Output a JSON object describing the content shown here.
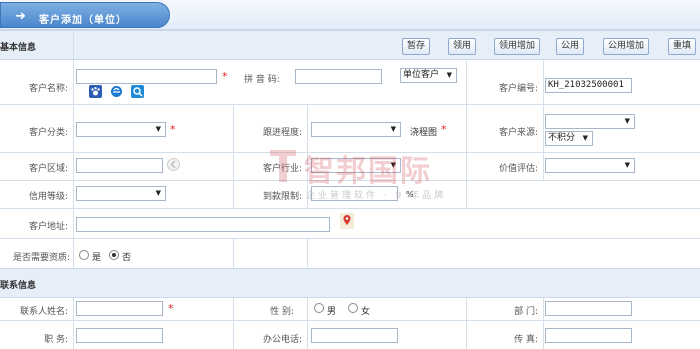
{
  "title": "客户添加（单位）",
  "sections": {
    "basic": "基本信息",
    "contact": "联系信息"
  },
  "toolbar": {
    "save_draft": "暂存",
    "use": "领用",
    "use_add": "领用增加",
    "public": "公用",
    "public_add": "公用增加",
    "reset": "重填"
  },
  "basic": {
    "name_label": "客户名称:",
    "name_value": "",
    "pinyin_label": "拼 音 码:",
    "pinyin_value": "",
    "customer_type_value": "单位客户",
    "code_label": "客户编号:",
    "code_value": "KH_21032500001",
    "category_label": "客户分类:",
    "progress_label": "跟进程度:",
    "flow_link": "浇程图",
    "source_label": "客户来源:",
    "points_value": "不积分",
    "region_label": "客户区域:",
    "industry_label": "客户行业:",
    "value_label": "价值评估:",
    "credit_label": "信用等级:",
    "due_limit_label": "到款限制:",
    "percent": "%",
    "address_label": "客户地址:",
    "qualification_label": "是否需要资质:",
    "yes": "是",
    "no": "否"
  },
  "contact": {
    "person_label": "联系人姓名:",
    "gender_label": "性    别:",
    "male": "男",
    "female": "女",
    "dept_label": "部    门:",
    "position_label": "职    务:",
    "office_phone_label": "办公电话:",
    "fax_label": "传    真:"
  },
  "watermark": {
    "name": "智邦国际",
    "sub": "企业管理软件 · 9 年品牌"
  }
}
